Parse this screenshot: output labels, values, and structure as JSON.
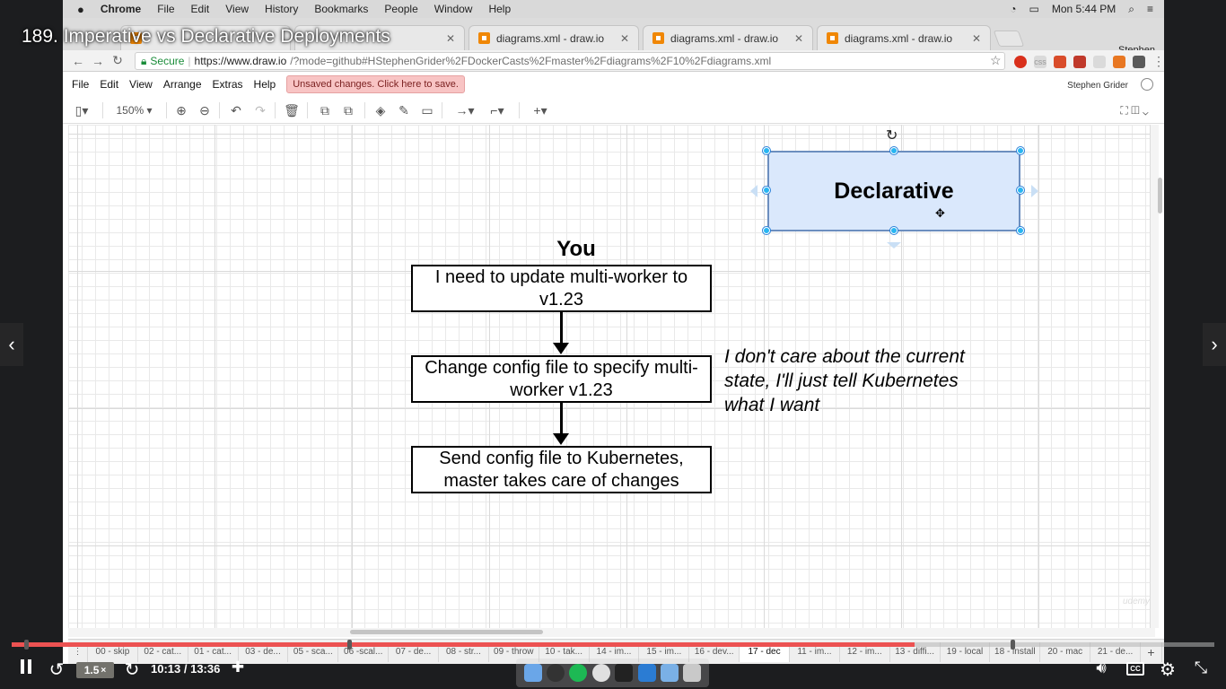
{
  "video": {
    "title": "189. Imperative vs Declarative Deployments",
    "speed": "1.5",
    "speed_suffix": "×",
    "current_time": "10:13",
    "duration": "13:36",
    "time_separator": " / ",
    "progress": 0.751,
    "colors": {
      "progress": "#ec5252",
      "track": "#b4b4b4"
    }
  },
  "mac_menubar": {
    "app_name": "Chrome",
    "menus": [
      "File",
      "Edit",
      "View",
      "History",
      "Bookmarks",
      "People",
      "Window",
      "Help"
    ],
    "clock": "Mon 5:44 PM"
  },
  "browser": {
    "tabs": [
      {
        "label": "diagrams.xml - draw.io"
      },
      {
        "label": "diagrams.xml - draw.io"
      },
      {
        "label": "diagrams.xml - draw.io"
      }
    ],
    "profile_name": "Stephen",
    "secure_label": "Secure",
    "url_domain": "https://www.draw.io",
    "url_path": "/?mode=github#HStephenGrider%2FDockerCasts%2Fmaster%2Fdiagrams%2F10%2Fdiagrams.xml"
  },
  "drawio": {
    "menus": [
      "File",
      "Edit",
      "View",
      "Arrange",
      "Extras",
      "Help"
    ],
    "unsaved_label": "Unsaved changes. Click here to save.",
    "user_name": "Stephen Grider",
    "zoom": "150%",
    "pages": [
      "00 - skip",
      "02 - cat...",
      "01 - cat...",
      "03 - de...",
      "05 - sca...",
      "06 -scal...",
      "07 - de...",
      "08 - str...",
      "09 - throw",
      "10 - tak...",
      "14 - im...",
      "15 - im...",
      "16 - dev...",
      "17 - dec",
      "11 - im...",
      "12 - im...",
      "13 - diffi...",
      "19 - local",
      "18 - install",
      "20 - mac",
      "21 - de..."
    ],
    "active_page": "17 - dec"
  },
  "diagram": {
    "heading": "You",
    "steps": [
      "I need to update multi-worker to v1.23",
      "Change config file to specify multi-worker v1.23",
      "Send config file to Kubernetes, master takes care of changes"
    ],
    "note": "I don't care about the current state, I'll just tell Kubernetes what I want",
    "selected_shape": "Declarative",
    "selected_fill": "#dae8fc",
    "selected_stroke": "#6c8ebf",
    "selection_color": "#29b6f2"
  },
  "icons": {
    "player": [
      "pause-icon",
      "rewind-icon",
      "forward-icon",
      "bookmark-icon",
      "volume-icon",
      "cc-icon",
      "settings-icon",
      "exit-fullscreen-icon"
    ],
    "nav": [
      "chevron-left-icon",
      "chevron-right-icon"
    ]
  }
}
